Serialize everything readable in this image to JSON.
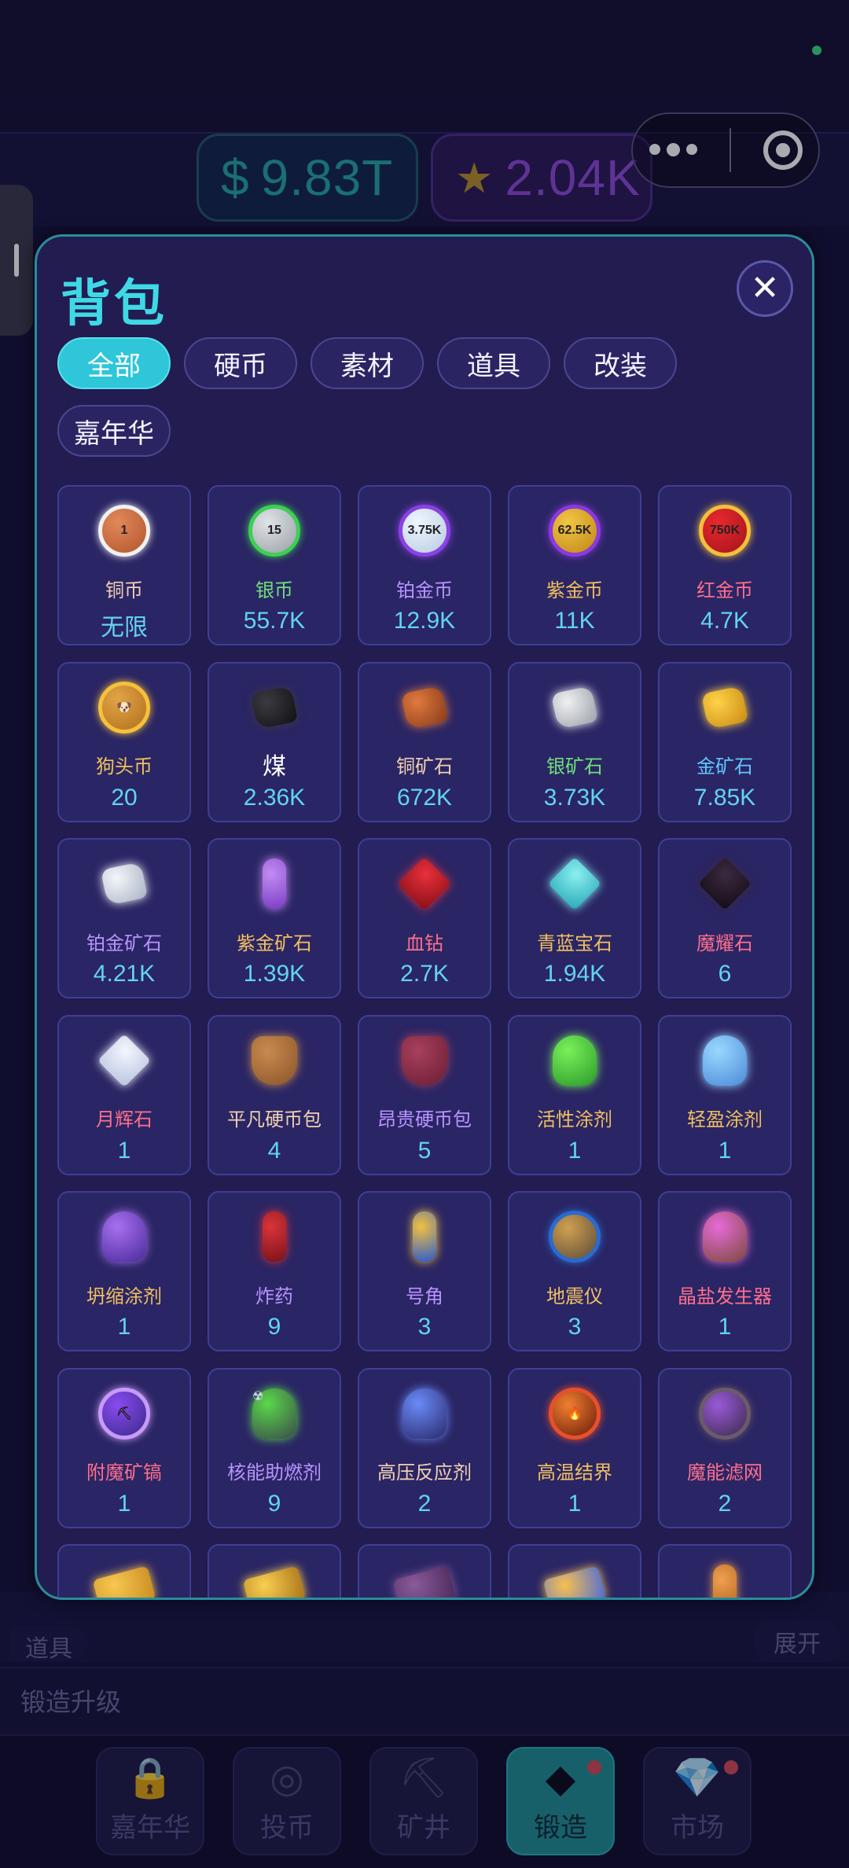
{
  "header": {
    "cash": "9.83T",
    "cash_symbol": "$",
    "stars": "2.04K",
    "star_icon": "star-icon",
    "menu_icon": "more-dots-icon",
    "close_app_icon": "target-icon"
  },
  "background": {
    "items_label": "道具",
    "expand_label": "展开",
    "forge_upgrade_label": "锻造升级"
  },
  "bottom_nav": [
    {
      "label": "嘉年华",
      "icon": "lock-icon",
      "badge": false,
      "active": false
    },
    {
      "label": "投币",
      "icon": "coin-slot-icon",
      "badge": false,
      "active": false
    },
    {
      "label": "矿井",
      "icon": "pickaxe-icon",
      "badge": false,
      "active": false
    },
    {
      "label": "锻造",
      "icon": "diamond-icon",
      "badge": true,
      "active": true
    },
    {
      "label": "市场",
      "icon": "gem-icon",
      "badge": true,
      "active": false
    }
  ],
  "modal": {
    "title": "背包",
    "close_icon": "close-icon",
    "filters": [
      "全部",
      "硬币",
      "素材",
      "道具",
      "改装",
      "嘉年华"
    ],
    "active_filter": "全部",
    "items": [
      {
        "name": "铜币",
        "count": "无限",
        "color": "#f0d0b0",
        "icon": "copper-coin-icon",
        "art": "coin",
        "c1": "#e2895a",
        "c2": "#b0552c",
        "ring": "#f1f1f1",
        "label": "1"
      },
      {
        "name": "银币",
        "count": "55.7K",
        "color": "#6fe07a",
        "icon": "silver-coin-icon",
        "art": "coin",
        "c1": "#dfe3e8",
        "c2": "#9aa0a8",
        "ring": "#3ecf54",
        "label": "15"
      },
      {
        "name": "铂金币",
        "count": "12.9K",
        "color": "#b894ff",
        "icon": "platinum-coin-icon",
        "art": "coin",
        "c1": "#eef6ff",
        "c2": "#b8cbe0",
        "ring": "#8a42e4",
        "label": "3.75K"
      },
      {
        "name": "紫金币",
        "count": "11K",
        "color": "#f0c060",
        "icon": "purple-gold-coin-icon",
        "art": "coin",
        "c1": "#f2c645",
        "c2": "#c08616",
        "ring": "#8a3adc",
        "label": "62.5K"
      },
      {
        "name": "红金币",
        "count": "4.7K",
        "color": "#ff6f8c",
        "icon": "red-gold-coin-icon",
        "art": "coin",
        "c1": "#e8282e",
        "c2": "#a3141c",
        "ring": "#f5c13c",
        "label": "750K"
      },
      {
        "name": "狗头币",
        "count": "20",
        "color": "#f0c060",
        "icon": "doge-coin-icon",
        "art": "coin",
        "c1": "#e2a445",
        "c2": "#b0701e",
        "ring": "#f5c13c",
        "label": "🐶"
      },
      {
        "name": "煤",
        "count": "2.36K",
        "color": "#ffffff",
        "icon": "coal-icon",
        "art": "ore",
        "c1": "#3a3a40",
        "c2": "#111114",
        "ring": "",
        "label": ""
      },
      {
        "name": "铜矿石",
        "count": "672K",
        "color": "#f0d0b0",
        "icon": "copper-ore-icon",
        "art": "ore",
        "c1": "#e07a3e",
        "c2": "#8a3a1a",
        "ring": "",
        "label": ""
      },
      {
        "name": "银矿石",
        "count": "3.73K",
        "color": "#6fe07a",
        "icon": "silver-ore-icon",
        "art": "ore",
        "c1": "#f0f0f2",
        "c2": "#9aa0a8",
        "ring": "",
        "label": ""
      },
      {
        "name": "金矿石",
        "count": "7.85K",
        "color": "#5ec8ff",
        "icon": "gold-ore-icon",
        "art": "ore",
        "c1": "#ffd34a",
        "c2": "#c98a10",
        "ring": "",
        "label": ""
      },
      {
        "name": "铂金矿石",
        "count": "4.21K",
        "color": "#b894ff",
        "icon": "platinum-ore-icon",
        "art": "ore",
        "c1": "#f4f6fa",
        "c2": "#a9b2c4",
        "ring": "",
        "label": ""
      },
      {
        "name": "紫金矿石",
        "count": "1.39K",
        "color": "#f0c060",
        "icon": "purple-gold-ore-icon",
        "art": "crystal",
        "c1": "#c28cf2",
        "c2": "#7a3cc4",
        "ring": "",
        "label": ""
      },
      {
        "name": "血钻",
        "count": "2.7K",
        "color": "#ff6f8c",
        "icon": "blood-diamond-icon",
        "art": "gem",
        "c1": "#e8303a",
        "c2": "#8a0e18",
        "ring": "",
        "label": ""
      },
      {
        "name": "青蓝宝石",
        "count": "1.94K",
        "color": "#f0c060",
        "icon": "cyan-sapphire-icon",
        "art": "gem",
        "c1": "#8af0f0",
        "c2": "#2aa8b8",
        "ring": "",
        "label": ""
      },
      {
        "name": "魔耀石",
        "count": "6",
        "color": "#ff6f8c",
        "icon": "demon-stone-icon",
        "art": "gem",
        "c1": "#3a2a3e",
        "c2": "#150c18",
        "ring": "",
        "label": ""
      },
      {
        "name": "月辉石",
        "count": "1",
        "color": "#ff6f8c",
        "icon": "moonstone-icon",
        "art": "gem",
        "c1": "#f4f6ff",
        "c2": "#b8c4dc",
        "ring": "",
        "label": ""
      },
      {
        "name": "平凡硬币包",
        "count": "4",
        "color": "#f0d0b0",
        "icon": "common-coin-bag-icon",
        "art": "bag",
        "c1": "#c88a50",
        "c2": "#8a5428",
        "ring": "",
        "label": ""
      },
      {
        "name": "昂贵硬币包",
        "count": "5",
        "color": "#b894ff",
        "icon": "expensive-coin-bag-icon",
        "art": "bag",
        "c1": "#a8405c",
        "c2": "#6a1c34",
        "ring": "",
        "label": ""
      },
      {
        "name": "活性涂剂",
        "count": "1",
        "color": "#f0c060",
        "icon": "active-coating-icon",
        "art": "flask",
        "c1": "#7af05a",
        "c2": "#2a9a2a",
        "ring": "",
        "label": ""
      },
      {
        "name": "轻盈涂剂",
        "count": "1",
        "color": "#f0c060",
        "icon": "light-coating-icon",
        "art": "flask",
        "c1": "#9ad8ff",
        "c2": "#4a8ad8",
        "ring": "",
        "label": ""
      },
      {
        "name": "坍缩涂剂",
        "count": "1",
        "color": "#f0c060",
        "icon": "collapse-coating-icon",
        "art": "flask",
        "c1": "#a870f0",
        "c2": "#4a2a9a",
        "ring": "",
        "label": ""
      },
      {
        "name": "炸药",
        "count": "9",
        "color": "#b894ff",
        "icon": "dynamite-icon",
        "art": "crystal",
        "c1": "#d8333a",
        "c2": "#7a1418",
        "ring": "",
        "label": ""
      },
      {
        "name": "号角",
        "count": "3",
        "color": "#b894ff",
        "icon": "horn-icon",
        "art": "crystal",
        "c1": "#f0c040",
        "c2": "#2a5ad0",
        "ring": "",
        "label": ""
      },
      {
        "name": "地震仪",
        "count": "3",
        "color": "#f0c060",
        "icon": "seismograph-icon",
        "art": "coin",
        "c1": "#d0a050",
        "c2": "#5a4a3a",
        "ring": "#2a6ad0",
        "label": ""
      },
      {
        "name": "晶盐发生器",
        "count": "1",
        "color": "#ff6f8c",
        "icon": "crystal-salt-generator-icon",
        "art": "flask",
        "c1": "#e86ad8",
        "c2": "#7a4a3a",
        "ring": "",
        "label": ""
      },
      {
        "name": "附魔矿镐",
        "count": "1",
        "color": "#ff6f8c",
        "icon": "enchanted-pickaxe-icon",
        "art": "coin",
        "c1": "#8a4af0",
        "c2": "#3a2a8a",
        "ring": "#c89af8",
        "label": "⛏"
      },
      {
        "name": "核能助燃剂",
        "count": "9",
        "color": "#b894ff",
        "icon": "nuclear-accelerant-icon",
        "art": "flask",
        "c1": "#5ad84a",
        "c2": "#3a4a4a",
        "ring": "",
        "label": "☢"
      },
      {
        "name": "高压反应剂",
        "count": "2",
        "color": "#f0d0b0",
        "icon": "high-pressure-reagent-icon",
        "art": "flask",
        "c1": "#6a8af8",
        "c2": "#2a2a6a",
        "ring": "",
        "label": ""
      },
      {
        "name": "高温结界",
        "count": "1",
        "color": "#f0c060",
        "icon": "high-temp-barrier-icon",
        "art": "coin",
        "c1": "#f08030",
        "c2": "#6a1a0a",
        "ring": "#e8502a",
        "label": "🔥"
      },
      {
        "name": "魔能滤网",
        "count": "2",
        "color": "#ff6f8c",
        "icon": "magic-filter-icon",
        "art": "coin",
        "c1": "#9a5ad8",
        "c2": "#3a2a4a",
        "ring": "#6a5a6a",
        "label": ""
      },
      {
        "name": "",
        "count": "",
        "color": "#f0c060",
        "icon": "gold-ticket-icon",
        "art": "ticket",
        "c1": "#f8c850",
        "c2": "#c88a20",
        "ring": "",
        "label": ""
      },
      {
        "name": "",
        "count": "",
        "color": "#f0c060",
        "icon": "gold-ticket-icon",
        "art": "ticket",
        "c1": "#f8d050",
        "c2": "#a87018",
        "ring": "",
        "label": ""
      },
      {
        "name": "",
        "count": "",
        "color": "#f0c060",
        "icon": "purple-ticket-icon",
        "art": "ticket",
        "c1": "#8a5a9a",
        "c2": "#4a2a5a",
        "ring": "",
        "label": ""
      },
      {
        "name": "",
        "count": "",
        "color": "#f0c060",
        "icon": "blue-gold-ticket-icon",
        "art": "ticket",
        "c1": "#f8c050",
        "c2": "#4a6ad8",
        "ring": "",
        "label": ""
      },
      {
        "name": "",
        "count": "",
        "color": "#f0c060",
        "icon": "trumpet-icon",
        "art": "crystal",
        "c1": "#f0a050",
        "c2": "#a85a18",
        "ring": "",
        "label": ""
      }
    ]
  }
}
